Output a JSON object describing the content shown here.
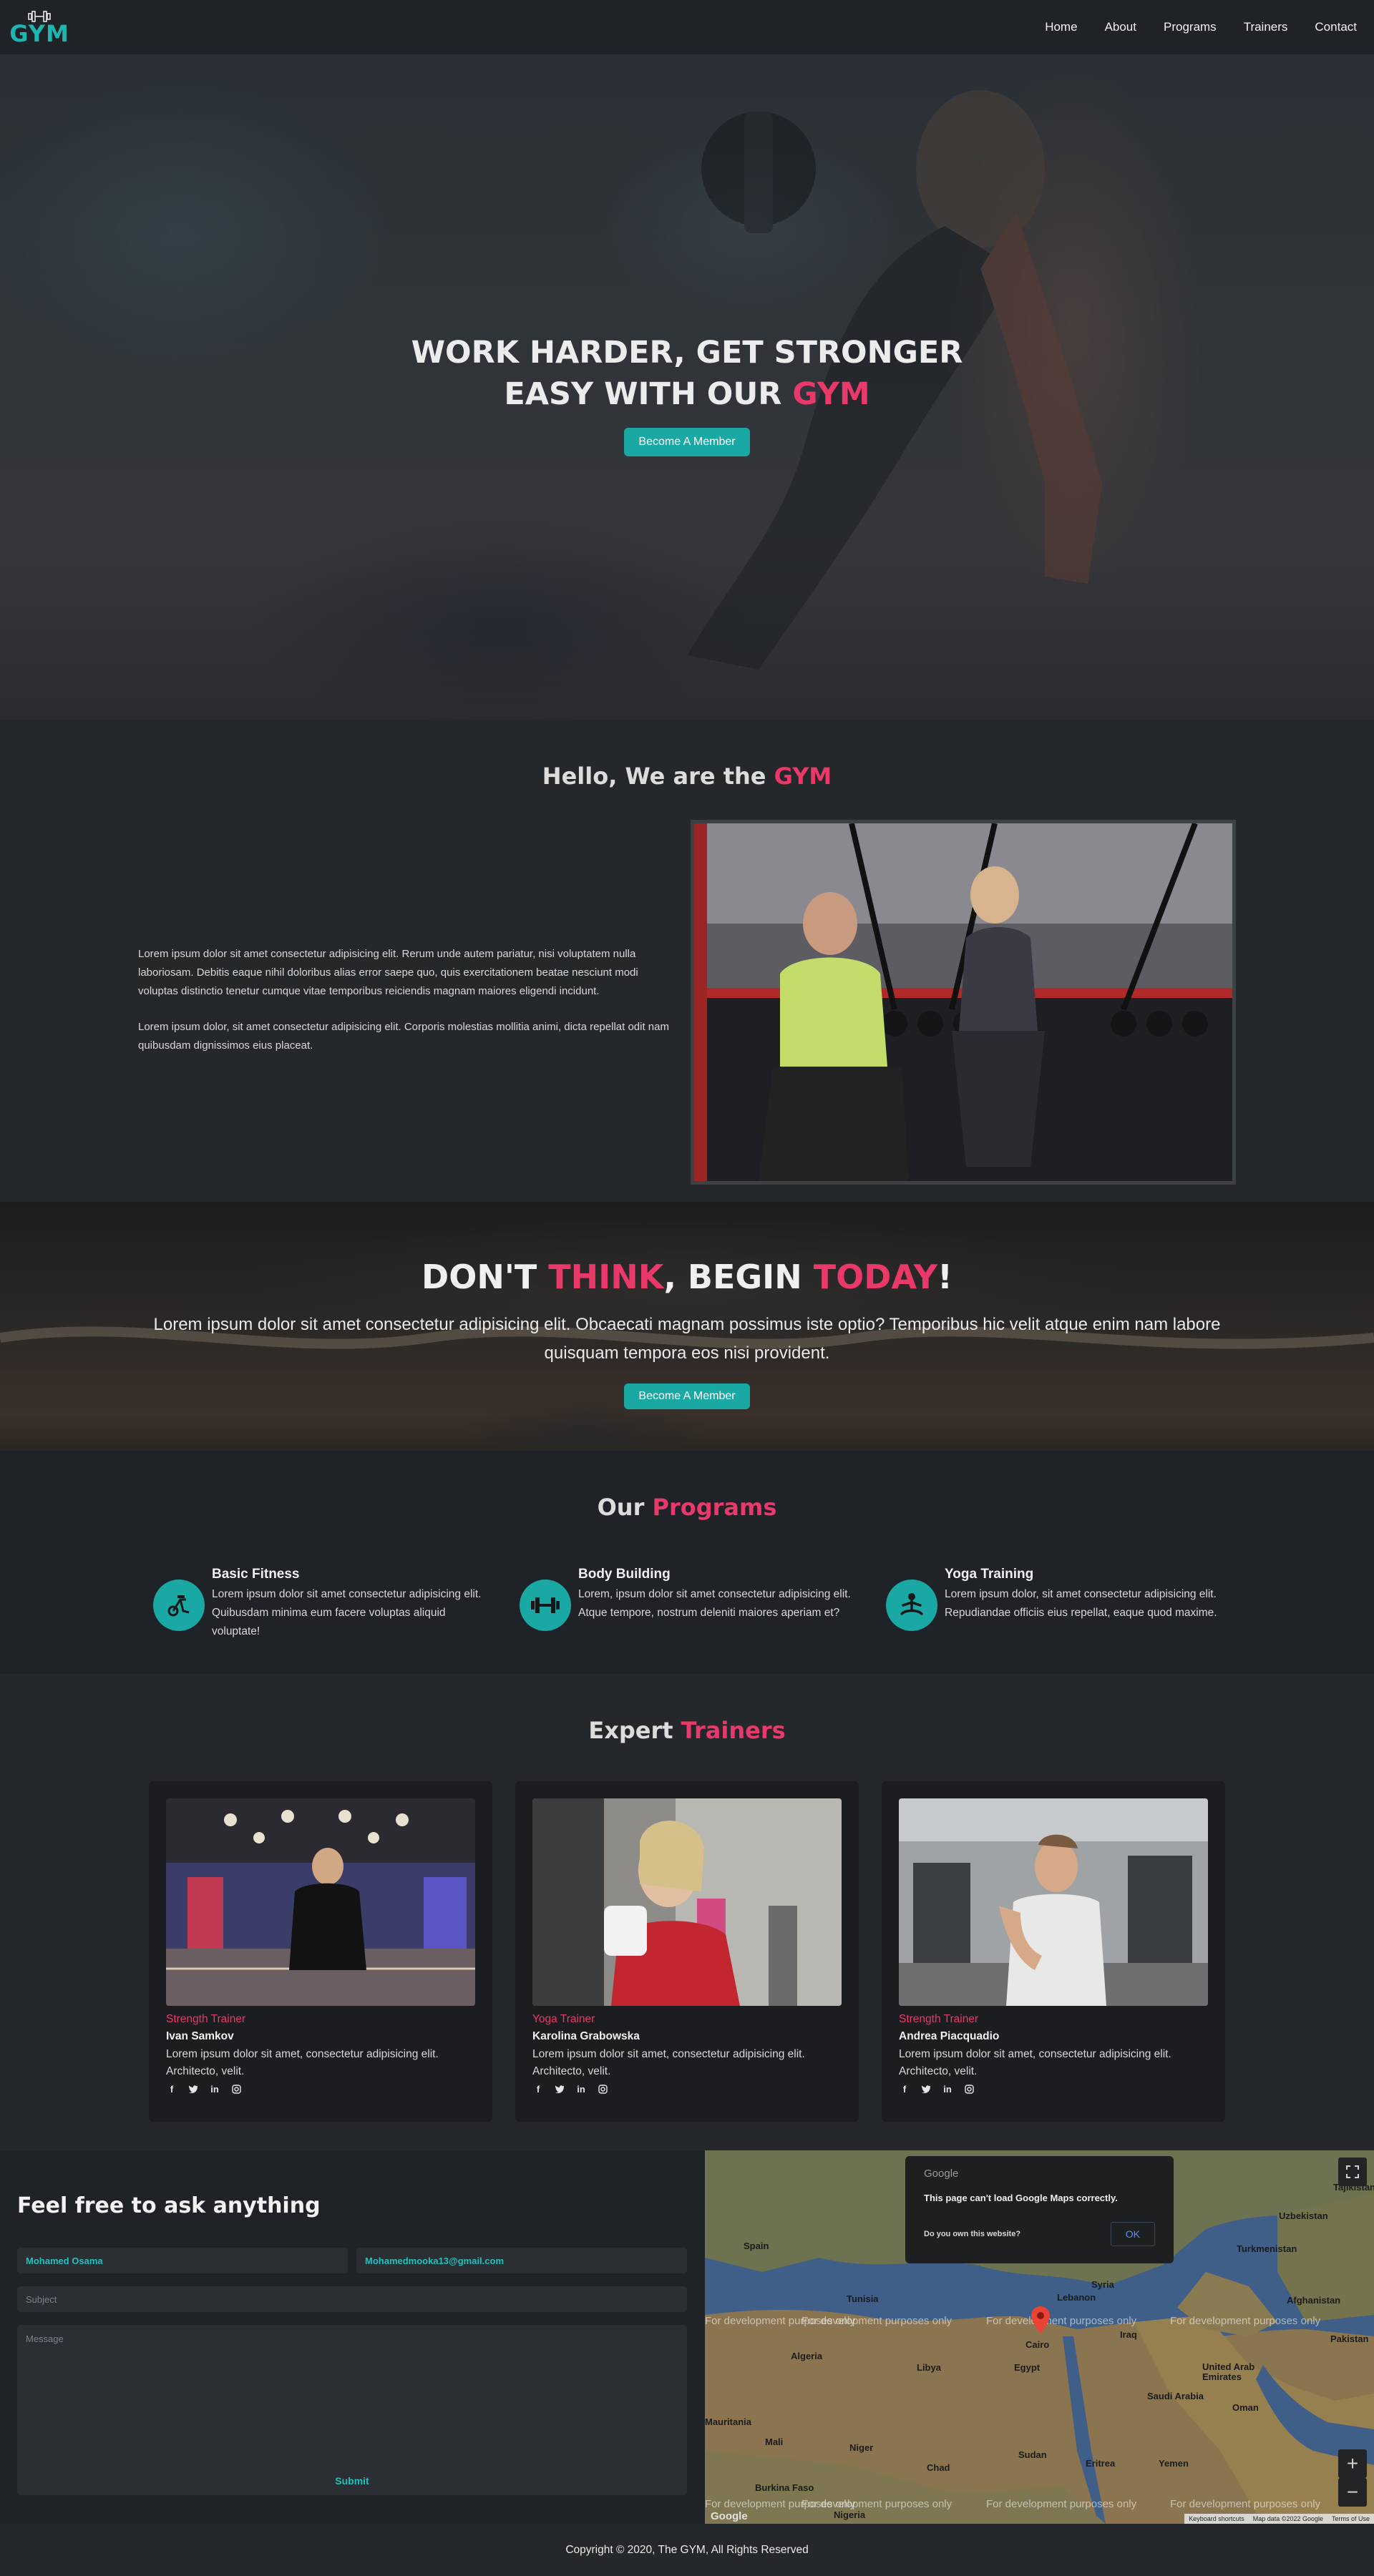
{
  "nav": {
    "logo_text": "GYM",
    "links": [
      "Home",
      "About",
      "Programs",
      "Trainers",
      "Contact"
    ]
  },
  "hero": {
    "line1": "WORK HARDER, GET STRONGER",
    "line2_prefix": "EASY WITH OUR ",
    "line2_accent": "GYM",
    "button": "Become A Member"
  },
  "about": {
    "title_prefix": "Hello, We are the ",
    "title_accent": "GYM",
    "paragraph1": "Lorem ipsum dolor sit amet consectetur adipisicing elit. Rerum unde autem pariatur, nisi voluptatem nulla laboriosam. Debitis eaque nihil doloribus alias error saepe quo, quis exercitationem beatae nesciunt modi voluptas distinctio tenetur cumque vitae temporibus reiciendis magnam maiores eligendi incidunt.",
    "paragraph2": "Lorem ipsum dolor, sit amet consectetur adipisicing elit. Corporis molestias mollitia animi, dicta repellat odit nam quibusdam dignissimos eius placeat."
  },
  "banner": {
    "w1": "DON'T ",
    "w2": "THINK",
    "w3": ", BEGIN ",
    "w4": "TODAY",
    "w5": "!",
    "text": "Lorem ipsum dolor sit amet consectetur adipisicing elit. Obcaecati magnam possimus iste optio? Temporibus hic velit atque enim nam labore quisquam tempora eos nisi provident.",
    "button": "Become A Member"
  },
  "programs": {
    "title_prefix": "Our ",
    "title_accent": "Programs",
    "items": [
      {
        "title": "Basic Fitness",
        "text": "Lorem ipsum dolor sit amet consectetur adipisicing elit. Quibusdam minima eum facere voluptas aliquid voluptate!",
        "icon": "exercise-bike-icon"
      },
      {
        "title": "Body Building",
        "text": "Lorem, ipsum dolor sit amet consectetur adipisicing elit. Atque tempore, nostrum deleniti maiores aperiam et?",
        "icon": "dumbbell-icon"
      },
      {
        "title": "Yoga Training",
        "text": "Lorem ipsum dolor, sit amet consectetur adipisicing elit. Repudiandae officiis eius repellat, eaque quod maxime.",
        "icon": "meditation-icon"
      }
    ]
  },
  "trainers": {
    "title_prefix": "Expert ",
    "title_accent": "Trainers",
    "items": [
      {
        "role": "Strength Trainer",
        "name": "Ivan Samkov",
        "text": "Lorem ipsum dolor sit amet, consectetur adipisicing elit. Architecto, velit."
      },
      {
        "role": "Yoga Trainer",
        "name": "Karolina Grabowska",
        "text": "Lorem ipsum dolor sit amet, consectetur adipisicing elit. Architecto, velit."
      },
      {
        "role": "Strength Trainer",
        "name": "Andrea Piacquadio",
        "text": "Lorem ipsum dolor sit amet, consectetur adipisicing elit. Architecto, velit."
      }
    ],
    "social_icons": [
      "facebook-icon",
      "twitter-icon",
      "linkedin-icon",
      "instagram-icon"
    ]
  },
  "contact": {
    "title": "Feel free to ask anything",
    "name_value": "Mohamed Osama",
    "email_value": "Mohamedmooka13@gmail.com",
    "subject_placeholder": "Subject",
    "message_placeholder": "Message",
    "submit": "Submit"
  },
  "map": {
    "dialog_brand": "Google",
    "dialog_message": "This page can't load Google Maps correctly.",
    "dialog_question": "Do you own this website?",
    "dialog_ok": "OK",
    "watermark": "For development purposes only",
    "places": [
      "Spain",
      "Tunisia",
      "Syria",
      "Lebanon",
      "Turkmenistan",
      "Uzbekistan",
      "Afghanistan",
      "Pakistan",
      "Algeria",
      "Libya",
      "Egypt",
      "Cairo",
      "Iraq",
      "Saudi Arabia",
      "United Arab Emirates",
      "Oman",
      "Yemen",
      "Sudan",
      "Eritrea",
      "Chad",
      "Niger",
      "Mali",
      "Mauritania",
      "Burkina Faso",
      "Nigeria",
      "Tajikistan"
    ],
    "footer_links": [
      "Keyboard shortcuts",
      "Map data ©2022 Google",
      "Terms of Use"
    ],
    "logo": "Google"
  },
  "footer": {
    "copyright": "Copyright © 2020, The GYM, All Rights Reserved"
  },
  "colors": {
    "accent_pink": "#e8396a",
    "accent_teal": "#1aa8a4",
    "background": "#25282b"
  }
}
